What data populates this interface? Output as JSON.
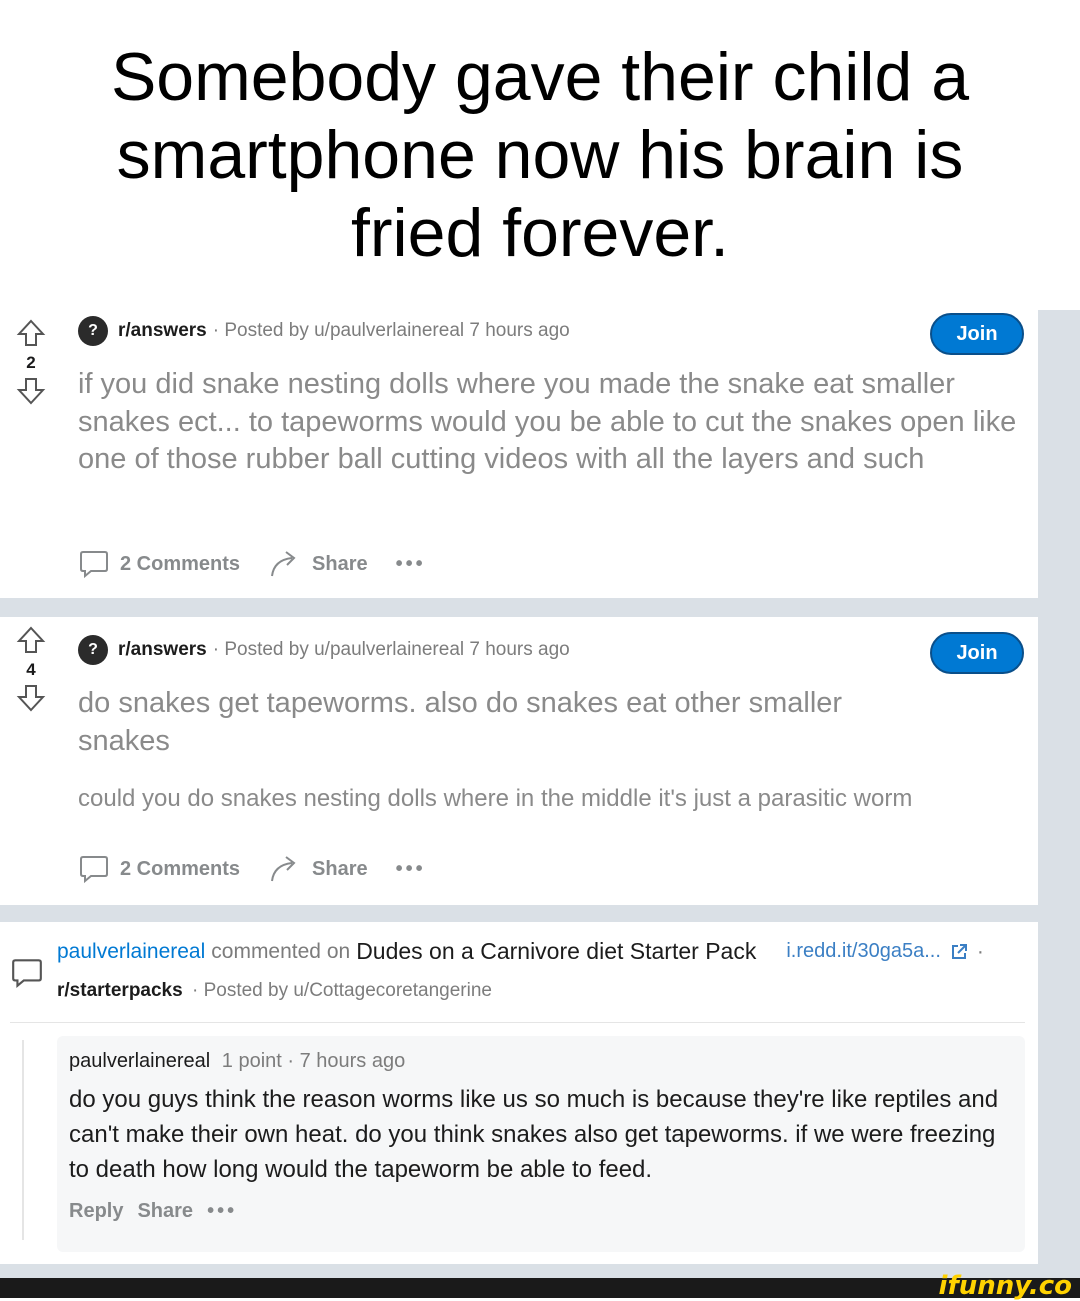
{
  "caption": {
    "line1": "Somebody gave their child a",
    "line2": "smartphone now his brain is",
    "line3": "fried forever."
  },
  "posts": [
    {
      "score": "2",
      "subreddit": "r/answers",
      "meta": "· Posted by u/paulverlainereal 7 hours ago",
      "join_label": "Join",
      "title": "if you did snake nesting dolls where you made the snake eat smaller snakes ect... to tapeworms would you be able to cut the snakes open like one of those rubber ball cutting videos with all the layers and such",
      "body": "",
      "comments_label": "2 Comments",
      "share_label": "Share",
      "more_label": "•••"
    },
    {
      "score": "4",
      "subreddit": "r/answers",
      "meta": "· Posted by u/paulverlainereal 7 hours ago",
      "join_label": "Join",
      "title": "do snakes get tapeworms. also do snakes eat other smaller snakes",
      "body": "could you do snakes nesting dolls where in the middle it's just a parasitic worm",
      "comments_label": "2 Comments",
      "share_label": "Share",
      "more_label": "•••"
    }
  ],
  "comment_card": {
    "author": "paulverlainereal",
    "commented_on": "commented on",
    "post_title": "Dudes on a Carnivore diet Starter Pack",
    "link": "i.redd.it/30ga5a...",
    "dot": "·",
    "subreddit": "r/starterpacks",
    "posted_by": "· Posted by u/Cottagecoretangerine",
    "comment": {
      "author": "paulverlainereal",
      "meta": "1 point · 7 hours ago",
      "text": "do you guys think the reason worms like us so much is because they're like reptiles and can't make their own heat. do you think snakes also get tapeworms. if we were freezing to death how long would the tapeworm be able to feed.",
      "reply_label": "Reply",
      "share_label": "Share",
      "more_label": "•••"
    }
  },
  "watermark": "ifunny.co",
  "colors": {
    "join_blue": "#0079d3",
    "feed_bg": "#dae0e6",
    "muted_text": "#8a8a8a",
    "watermark_yellow": "#ffd200"
  },
  "icons": [
    "upvote-icon",
    "downvote-icon",
    "comment-icon",
    "share-icon",
    "external-link-icon",
    "subreddit-avatar-icon"
  ]
}
